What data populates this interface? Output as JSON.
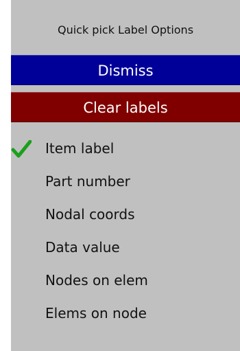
{
  "panel": {
    "title": "Quick pick Label Options",
    "dismiss_label": "Dismiss",
    "clear_label": "Clear labels",
    "options": [
      {
        "label": "Item label",
        "checked": true
      },
      {
        "label": "Part number",
        "checked": false
      },
      {
        "label": "Nodal coords",
        "checked": false
      },
      {
        "label": "Data value",
        "checked": false
      },
      {
        "label": "Nodes on elem",
        "checked": false
      },
      {
        "label": "Elems on node",
        "checked": false
      }
    ]
  },
  "colors": {
    "panel_bg": "#c0c0c0",
    "dismiss_bg": "#000099",
    "clear_bg": "#800000",
    "check": "#1aa01a"
  },
  "icons": {
    "check": "check-icon"
  }
}
